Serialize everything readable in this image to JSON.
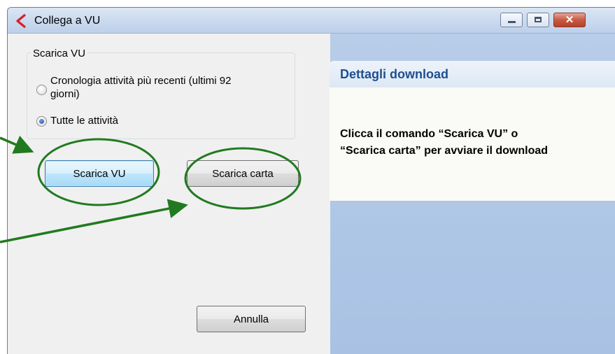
{
  "window": {
    "title": "Collega a VU"
  },
  "download_group": {
    "legend": "Scarica VU",
    "options": [
      {
        "label_line1": "Cronologia attività più recenti (ultimi 92",
        "label_line2": "giorni)",
        "checked": false
      },
      {
        "label_line1": "Tutte le attività",
        "checked": true
      }
    ]
  },
  "buttons": {
    "download_vu": "Scarica VU",
    "download_card": "Scarica carta",
    "cancel": "Annulla"
  },
  "details": {
    "title": "Dettagli download",
    "text_line1": "Clicca il comando “Scarica VU” o",
    "text_line2": "“Scarica carta” per avviare il download"
  },
  "colors": {
    "annotation": "#217a1f",
    "details_title": "#1d4f91",
    "right_panel": "#adc5e6"
  },
  "icons": {
    "app": "app-logo-icon",
    "minimize": "minimize-icon",
    "maximize": "maximize-icon",
    "close": "close-icon"
  }
}
